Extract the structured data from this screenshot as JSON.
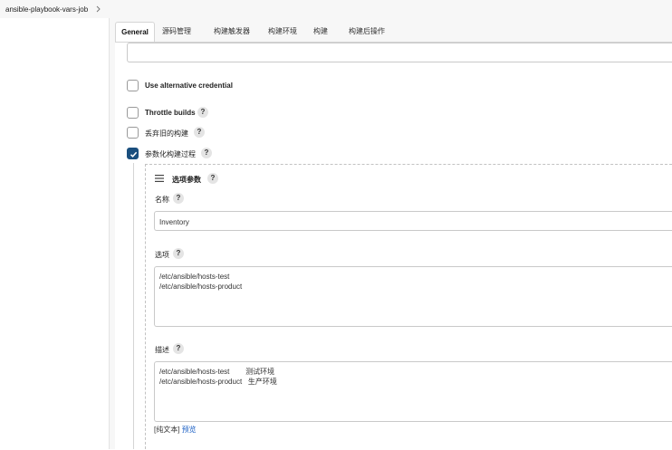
{
  "breadcrumb": {
    "job_name": "ansible-playbook-vars-job"
  },
  "tabs": [
    {
      "label": "General"
    },
    {
      "label": "源码管理"
    },
    {
      "label": "构建触发器"
    },
    {
      "label": "构建环境"
    },
    {
      "label": "构建"
    },
    {
      "label": "构建后操作"
    }
  ],
  "options": {
    "alt_credential": {
      "label": "Use alternative credential",
      "checked": false
    },
    "throttle": {
      "label": "Throttle builds",
      "checked": false
    },
    "discard": {
      "label": "丢弃旧的构建",
      "checked": false
    },
    "parameterized": {
      "label": "参数化构建过程",
      "checked": true
    }
  },
  "help_label": "?",
  "parameter": {
    "title": "选项参数",
    "name_label": "名称",
    "name_value": "Inventory",
    "choices_label": "选项",
    "choices": [
      "/etc/ansible/hosts-test",
      "/etc/ansible/hosts-product"
    ],
    "description_label": "描述",
    "description": [
      "/etc/ansible/hosts-test        测试环境",
      "/etc/ansible/hosts-product   生产环境"
    ],
    "plain_text_label": "[纯文本]",
    "preview_label": "预览"
  },
  "colors": {
    "accent": "#1a4f7e",
    "link": "#1a5fc4"
  }
}
